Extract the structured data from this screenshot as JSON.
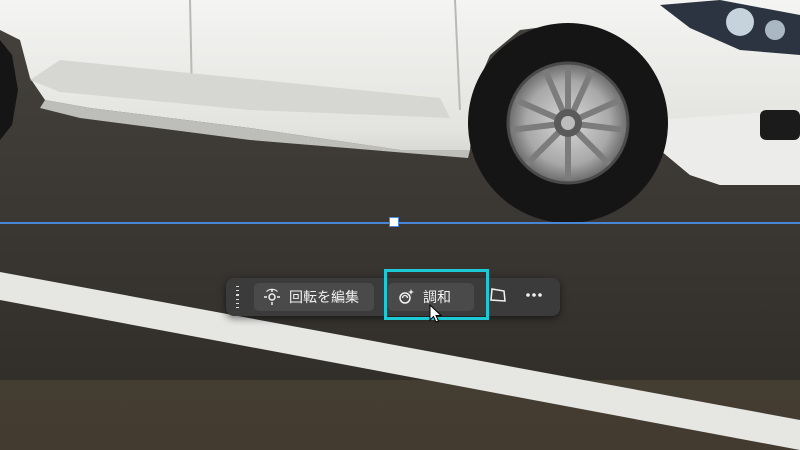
{
  "context_bar": {
    "edit_rotation_label": "回転を編集",
    "harmonize_label": "調和"
  },
  "icons": {
    "drag": "drag-handle-icon",
    "rotate": "rotate-icon",
    "harmonize": "harmonize-sparkle-icon",
    "perspective": "perspective-warp-icon",
    "more": "more-options-icon",
    "cursor": "mouse-pointer-icon"
  },
  "colors": {
    "highlight": "#1ec9d6",
    "selection": "#4a86d6",
    "toolbar_bg": "#3b3b3b",
    "button_bg": "#4a4a4a",
    "text": "#f2f2f2"
  }
}
